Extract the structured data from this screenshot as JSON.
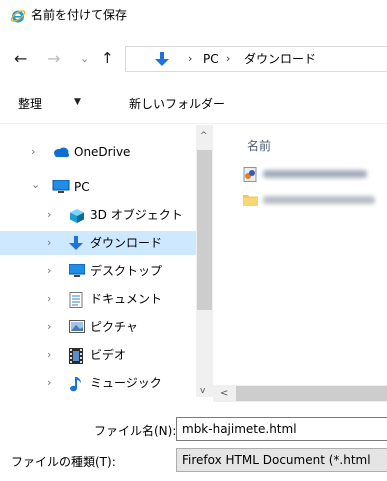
{
  "window": {
    "title": "名前を付けて保存",
    "icon": "internet-explorer-icon"
  },
  "toolbar": {
    "back": "←",
    "forward": "→",
    "recent": "⌄",
    "up": "↑"
  },
  "address": {
    "sep1": "›",
    "pc": "PC",
    "sep2": "›",
    "downloads": "ダウンロード"
  },
  "commands": {
    "organize": "整理",
    "organize_caret": "▼",
    "new_folder": "新しいフォルダー"
  },
  "nav": {
    "items": [
      {
        "label": "OneDrive",
        "chevron": "›",
        "icon": "onedrive-icon"
      },
      {
        "label": "PC",
        "chevron": "⌄",
        "icon": "pc-icon"
      },
      {
        "label": "3D オブジェクト",
        "chevron": "›",
        "icon": "3d-objects-icon"
      },
      {
        "label": "ダウンロード",
        "chevron": "›",
        "icon": "downloads-icon",
        "selected": true
      },
      {
        "label": "デスクトップ",
        "chevron": "›",
        "icon": "desktop-icon"
      },
      {
        "label": "ドキュメント",
        "chevron": "›",
        "icon": "documents-icon"
      },
      {
        "label": "ピクチャ",
        "chevron": "›",
        "icon": "pictures-icon"
      },
      {
        "label": "ビデオ",
        "chevron": "›",
        "icon": "videos-icon"
      },
      {
        "label": "ミュージック",
        "chevron": "›",
        "icon": "music-icon"
      }
    ],
    "scroll_up": "^",
    "scroll_down": "v"
  },
  "content": {
    "column_name": "名前",
    "files": [
      {
        "icon": "html-file-icon",
        "blurred": true
      },
      {
        "icon": "folder-icon",
        "blurred": true
      }
    ],
    "scroll_left": "<"
  },
  "form": {
    "filename_label": "ファイル名(N):",
    "filename_value": "mbk-hajimete.html",
    "filetype_label": "ファイルの種類(T):",
    "filetype_value": "Firefox HTML Document (*.html"
  },
  "colors": {
    "selection": "#cde8ff",
    "accent": "#0078d7",
    "column_header": "#4c607a"
  }
}
